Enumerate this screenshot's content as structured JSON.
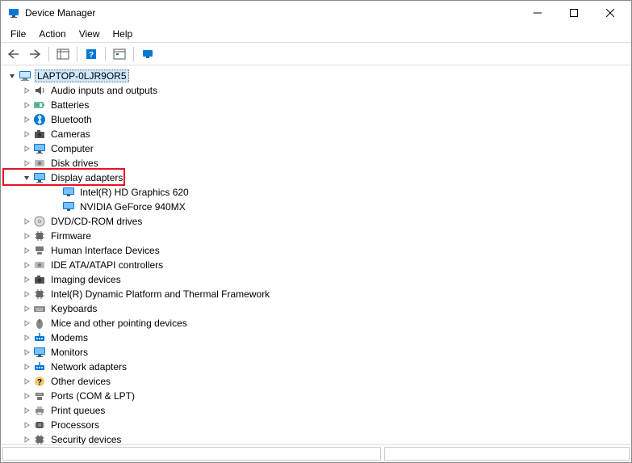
{
  "window": {
    "title": "Device Manager"
  },
  "menu": {
    "items": [
      "File",
      "Action",
      "View",
      "Help"
    ]
  },
  "tree": {
    "root": "LAPTOP-0LJR9OR5",
    "nodes": [
      {
        "label": "Audio inputs and outputs",
        "icon": "speaker",
        "expanded": false
      },
      {
        "label": "Batteries",
        "icon": "battery",
        "expanded": false
      },
      {
        "label": "Bluetooth",
        "icon": "bluetooth",
        "expanded": false
      },
      {
        "label": "Cameras",
        "icon": "camera",
        "expanded": false
      },
      {
        "label": "Computer",
        "icon": "monitor",
        "expanded": false
      },
      {
        "label": "Disk drives",
        "icon": "disk",
        "expanded": false
      },
      {
        "label": "Display adapters",
        "icon": "monitor",
        "expanded": true,
        "highlight": true,
        "children": [
          {
            "label": "Intel(R) HD Graphics 620",
            "icon": "gpu"
          },
          {
            "label": "NVIDIA GeForce 940MX",
            "icon": "gpu"
          }
        ]
      },
      {
        "label": "DVD/CD-ROM drives",
        "icon": "dvd",
        "expanded": false
      },
      {
        "label": "Firmware",
        "icon": "chip",
        "expanded": false
      },
      {
        "label": "Human Interface Devices",
        "icon": "hid",
        "expanded": false
      },
      {
        "label": "IDE ATA/ATAPI controllers",
        "icon": "disk",
        "expanded": false
      },
      {
        "label": "Imaging devices",
        "icon": "camera",
        "expanded": false
      },
      {
        "label": "Intel(R) Dynamic Platform and Thermal Framework",
        "icon": "chip",
        "expanded": false
      },
      {
        "label": "Keyboards",
        "icon": "kb",
        "expanded": false
      },
      {
        "label": "Mice and other pointing devices",
        "icon": "mouse",
        "expanded": false
      },
      {
        "label": "Modems",
        "icon": "net",
        "expanded": false
      },
      {
        "label": "Monitors",
        "icon": "monitor",
        "expanded": false
      },
      {
        "label": "Network adapters",
        "icon": "net",
        "expanded": false
      },
      {
        "label": "Other devices",
        "icon": "unknown",
        "expanded": false
      },
      {
        "label": "Ports (COM & LPT)",
        "icon": "port",
        "expanded": false
      },
      {
        "label": "Print queues",
        "icon": "print",
        "expanded": false
      },
      {
        "label": "Processors",
        "icon": "cpu",
        "expanded": false
      },
      {
        "label": "Security devices",
        "icon": "chip",
        "expanded": false
      }
    ]
  }
}
